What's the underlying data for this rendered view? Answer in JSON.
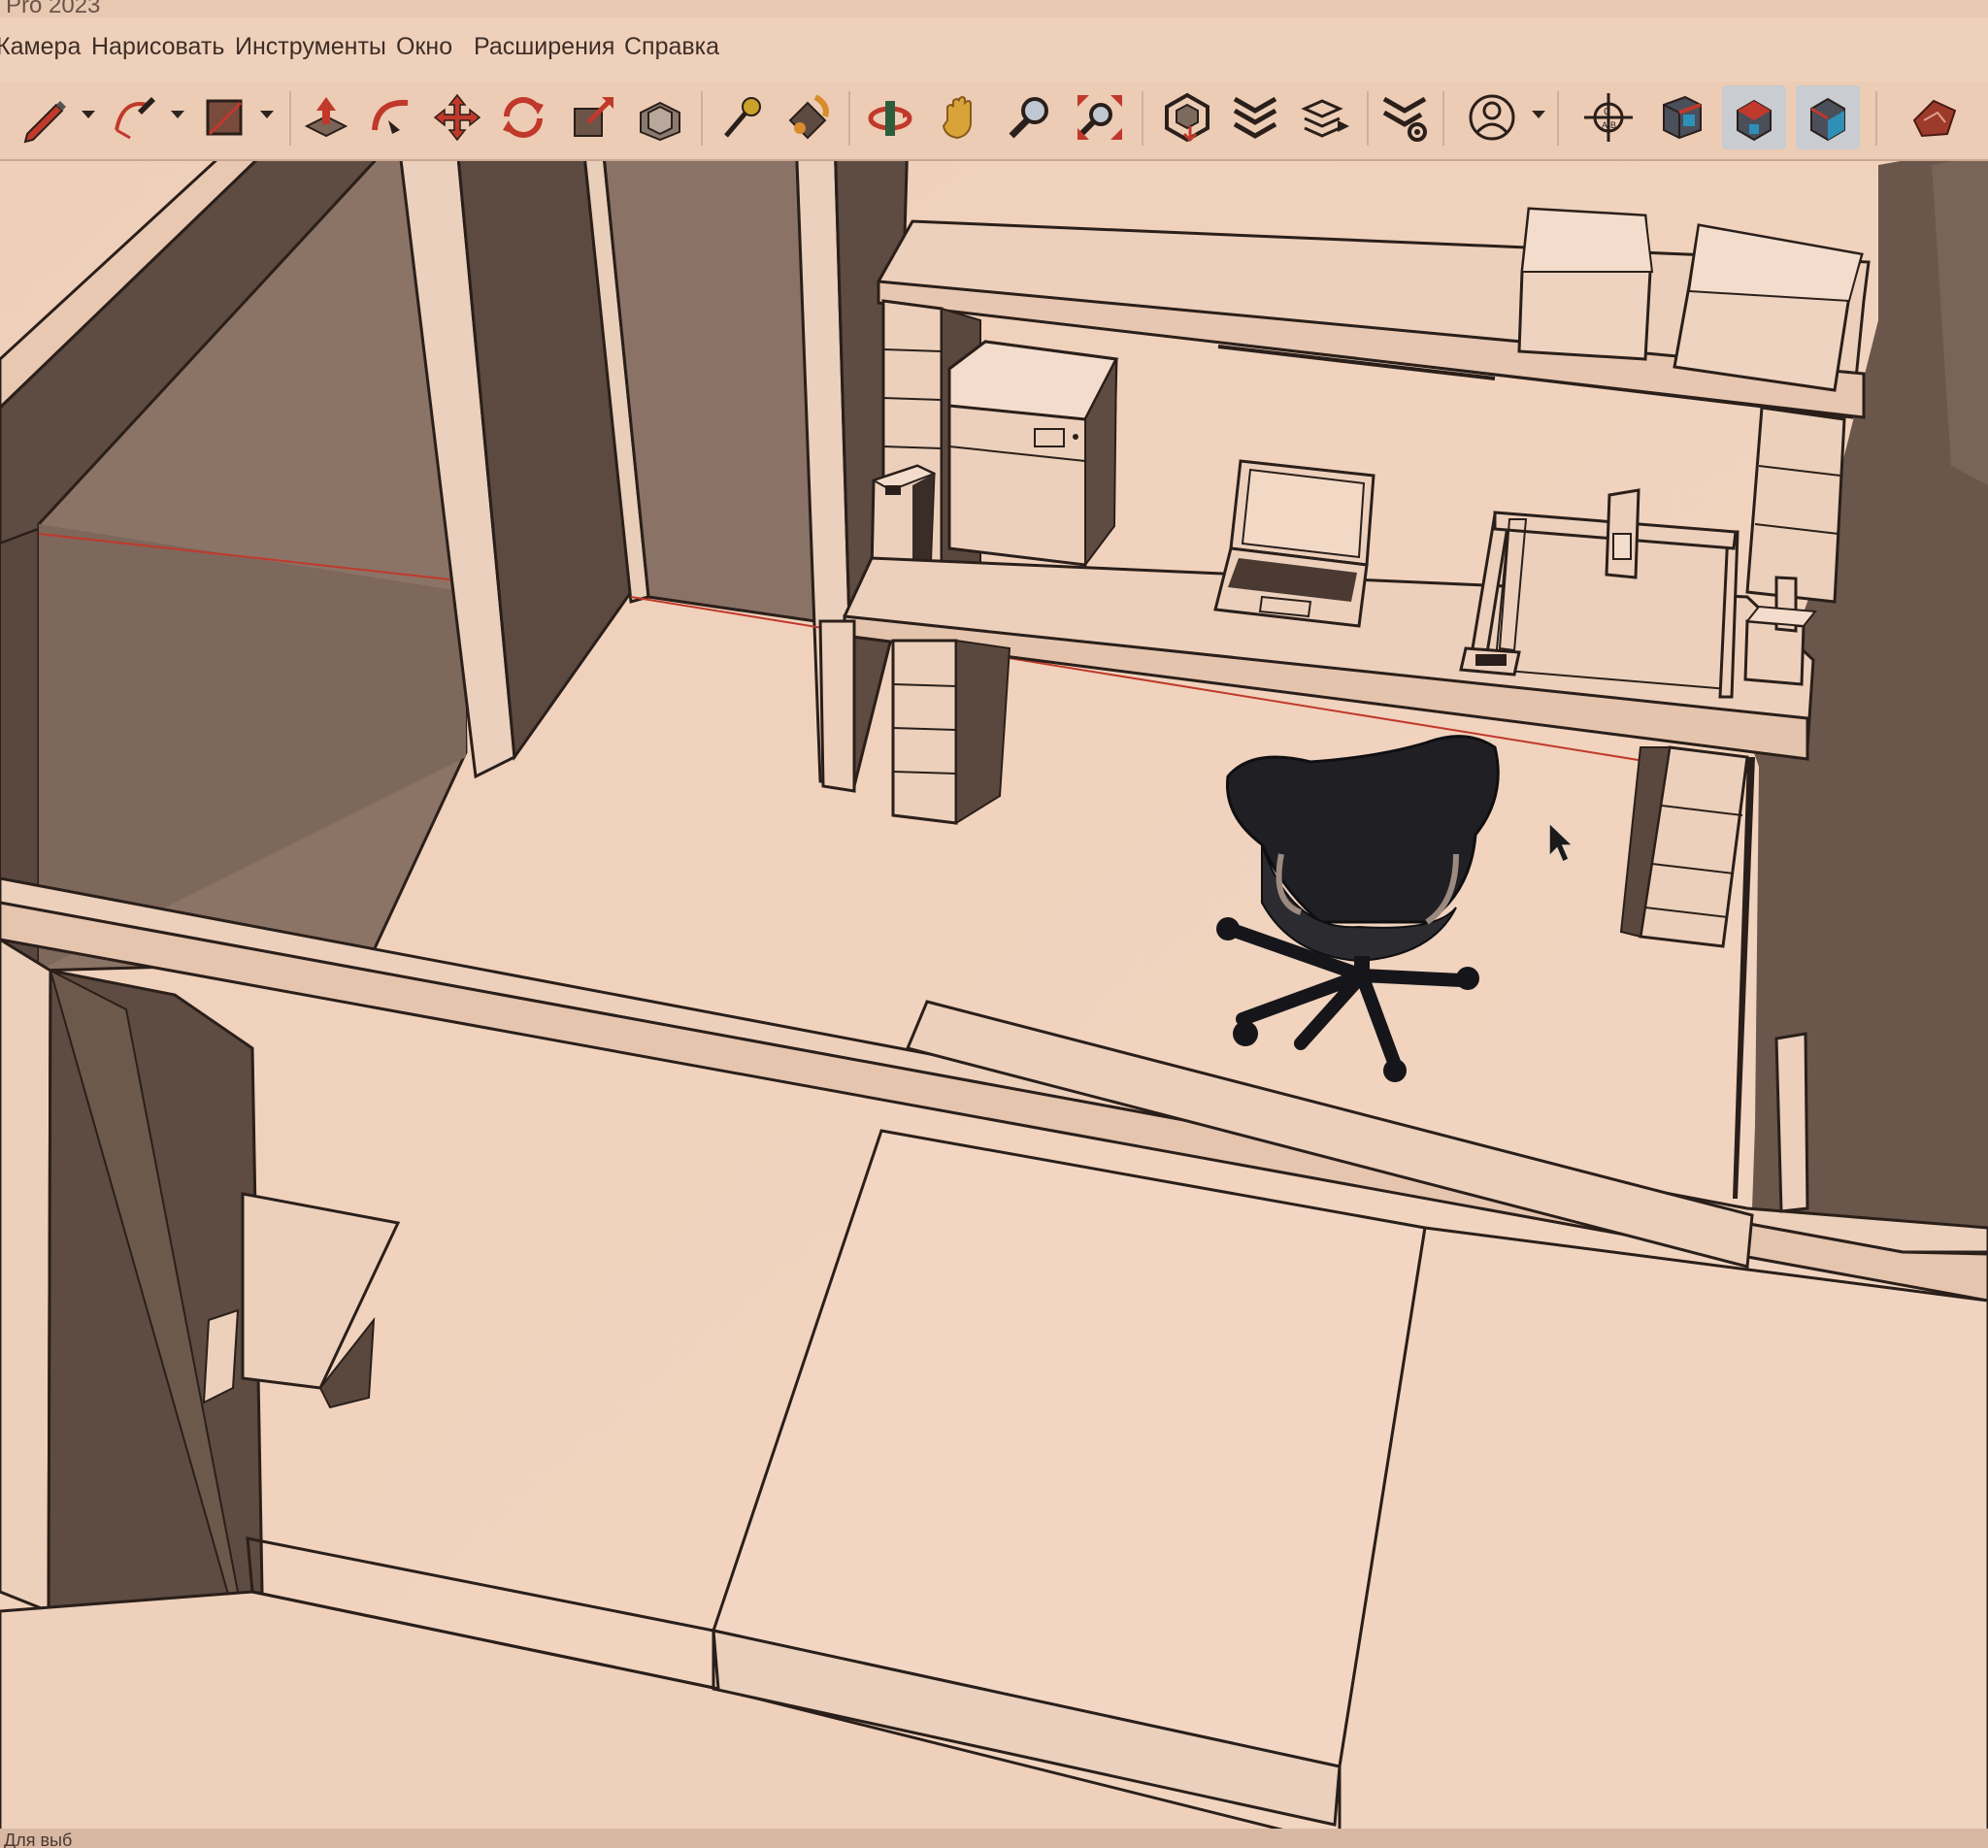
{
  "window": {
    "title": "Pro 2023"
  },
  "menu": {
    "items": [
      "Камера",
      "Нарисовать",
      "Инструменты",
      "Окно",
      "Расширения",
      "Справка"
    ]
  },
  "toolbar": {
    "tools": [
      {
        "icon": "pencil-icon",
        "dropdown": true
      },
      {
        "icon": "arc-icon",
        "dropdown": true
      },
      {
        "icon": "rectangle-icon",
        "dropdown": true
      },
      {
        "icon": "push-pull-icon"
      },
      {
        "icon": "follow-me-icon"
      },
      {
        "icon": "move-icon"
      },
      {
        "icon": "rotate-icon"
      },
      {
        "icon": "scale-icon"
      },
      {
        "icon": "offset-icon"
      },
      {
        "icon": "tape-measure-icon"
      },
      {
        "icon": "paint-bucket-icon"
      },
      {
        "icon": "orbit-icon"
      },
      {
        "icon": "pan-icon"
      },
      {
        "icon": "zoom-icon"
      },
      {
        "icon": "zoom-extents-icon"
      },
      {
        "icon": "3d-warehouse-icon"
      },
      {
        "icon": "extension-warehouse-icon"
      },
      {
        "icon": "layout-send-icon"
      },
      {
        "icon": "extension-manager-icon"
      },
      {
        "icon": "user-account-icon",
        "dropdown": true
      },
      {
        "icon": "section-plane-icon"
      },
      {
        "icon": "view-iso-icon"
      },
      {
        "icon": "view-top-icon",
        "pressed": true
      },
      {
        "icon": "view-front-icon",
        "pressed": true
      },
      {
        "icon": "ruby-console-icon"
      }
    ]
  },
  "statusbar": {
    "text": "Для выб"
  },
  "colors": {
    "background": "#f0d2bd",
    "edge": "#2a1f1a",
    "axis_red": "#c0392b",
    "wall_dark": "#6e5a4f",
    "chair": "#1f1f24"
  }
}
